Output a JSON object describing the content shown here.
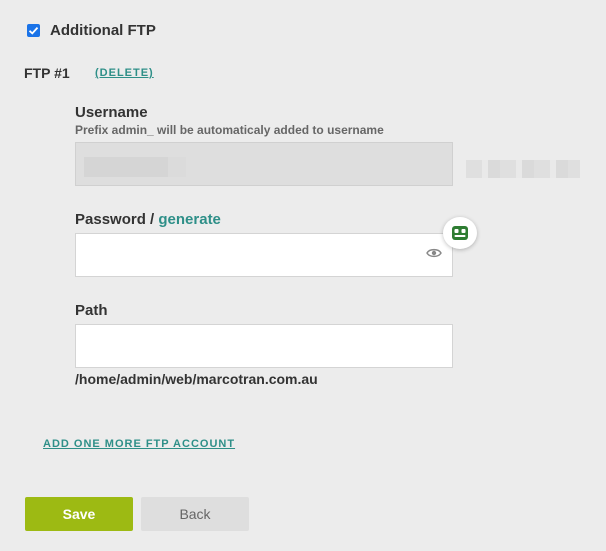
{
  "ftp": {
    "checkbox_label": "Additional FTP",
    "checked": true,
    "account_title": "FTP #1",
    "delete_label": "(DELETE)"
  },
  "username": {
    "label": "Username",
    "hint": "Prefix admin_ will be automaticaly added to username",
    "value": ""
  },
  "password": {
    "label": "Password /",
    "generate_label": "generate",
    "value": ""
  },
  "path": {
    "label": "Path",
    "value": "",
    "full_path": "/home/admin/web/marcotran.com.au"
  },
  "add_more_label": "ADD ONE MORE FTP ACCOUNT",
  "buttons": {
    "save": "Save",
    "back": "Back"
  },
  "colors": {
    "accent": "#2e8f88",
    "save_button": "#9dba13",
    "checkbox": "#1a73e8",
    "password_manager_icon": "#2e7d32"
  },
  "icons": [
    "checkbox-checked-icon",
    "eye-icon",
    "password-manager-icon"
  ]
}
